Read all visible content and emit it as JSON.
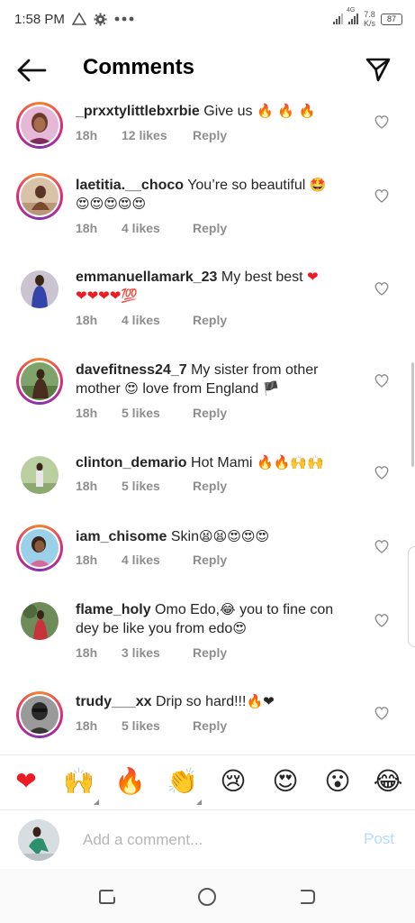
{
  "status_bar": {
    "time": "1:58 PM",
    "net_top": "4G",
    "speed_value": "7.8",
    "speed_unit": "K/s",
    "battery": "87"
  },
  "header": {
    "title": "Comments"
  },
  "comments": [
    {
      "username": "_prxxtylittlebxrbie",
      "text": "Give us",
      "emoji": "🔥 🔥 🔥",
      "time": "18h",
      "likes": "12 likes",
      "reply": "Reply",
      "ring": true
    },
    {
      "username": "laetitia.__choco",
      "text": "You’re so beautiful",
      "emoji": "🤩",
      "emoji_line2": "😍😍😍😍😍",
      "time": "18h",
      "likes": "4 likes",
      "reply": "Reply",
      "ring": true
    },
    {
      "username": "emmanuellamark_23",
      "text": "My best best",
      "emoji": "❤",
      "emoji_line2": "❤❤❤❤💯",
      "time": "18h",
      "likes": "4 likes",
      "reply": "Reply",
      "ring": false
    },
    {
      "username": "davefitness24_7",
      "text": "My sister from other mother",
      "emoji": "😍",
      "text_after": "love from England",
      "flag": "🏴",
      "time": "18h",
      "likes": "5 likes",
      "reply": "Reply",
      "ring": true
    },
    {
      "username": "clinton_demario",
      "text": "Hot Mami",
      "emoji": "🔥🔥🙌🙌",
      "time": "18h",
      "likes": "5 likes",
      "reply": "Reply",
      "ring": false
    },
    {
      "username": "iam_chisome",
      "text": "Skin",
      "emoji": "😫😫😍😍😍",
      "time": "18h",
      "likes": "4 likes",
      "reply": "Reply",
      "ring": true
    },
    {
      "username": "flame_holy",
      "text": "Omo Edo,",
      "emoji": "😂",
      "text_after": "you to fine con dey be like you from edo",
      "emoji_end": "😍",
      "time": "18h",
      "likes": "3 likes",
      "reply": "Reply",
      "ring": false
    },
    {
      "username": "trudy___xx",
      "text": "Drip so hard!!!",
      "emoji": "🔥❤",
      "time": "18h",
      "likes": "5 likes",
      "reply": "Reply",
      "ring": true
    }
  ],
  "reactions": [
    "❤",
    "🙌",
    "🔥",
    "👏",
    "😢",
    "😍",
    "😮",
    "😂"
  ],
  "add_comment": {
    "placeholder": "Add a comment...",
    "post_label": "Post"
  },
  "colors": {
    "accent": "#0095f6",
    "post_disabled": "#b3dbff",
    "muted": "#8e8e8e",
    "heart": "#ed1c24"
  }
}
